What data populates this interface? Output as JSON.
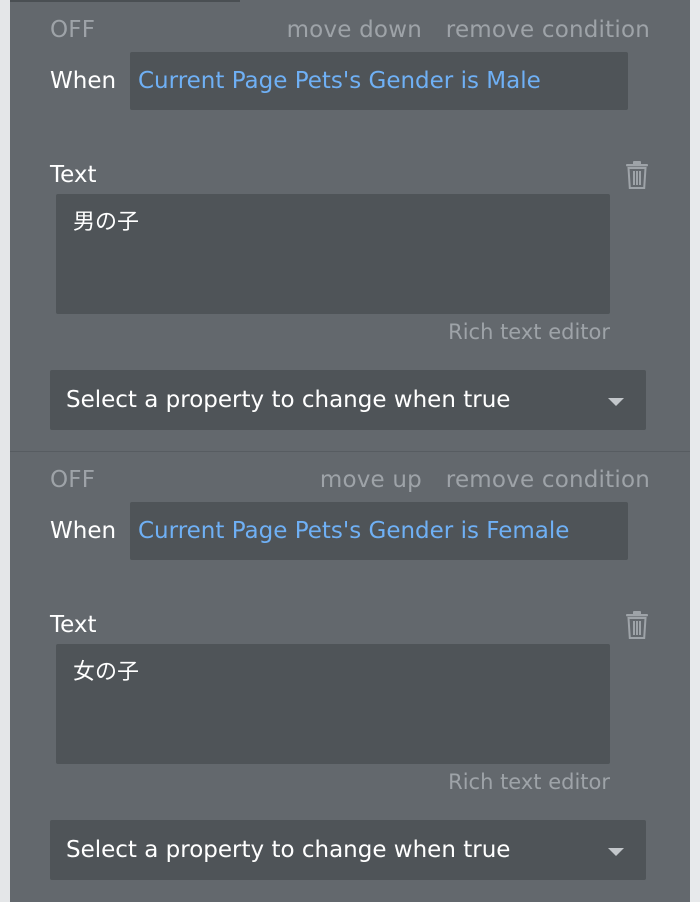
{
  "conditions": [
    {
      "state": "OFF",
      "move_label": "move down",
      "remove_label": "remove condition",
      "when_label": "When",
      "when_expression": "Current Page Pets's Gender is Male",
      "property_label": "Text",
      "text_value": "男の子",
      "rich_text_label": "Rich text editor",
      "select_placeholder": "Select a property to change when true"
    },
    {
      "state": "OFF",
      "move_label": "move up",
      "remove_label": "remove condition",
      "when_label": "When",
      "when_expression": "Current Page Pets's Gender is Female",
      "property_label": "Text",
      "text_value": "女の子",
      "rich_text_label": "Rich text editor",
      "select_placeholder": "Select a property to change when true"
    }
  ],
  "icons": {
    "delete": "trash-icon",
    "dropdown": "chevron-down-icon"
  },
  "colors": {
    "panel_bg": "#63686d",
    "field_bg": "#4f5458",
    "expression_text": "#6fb0f5",
    "muted_text": "#9ea3a8"
  }
}
